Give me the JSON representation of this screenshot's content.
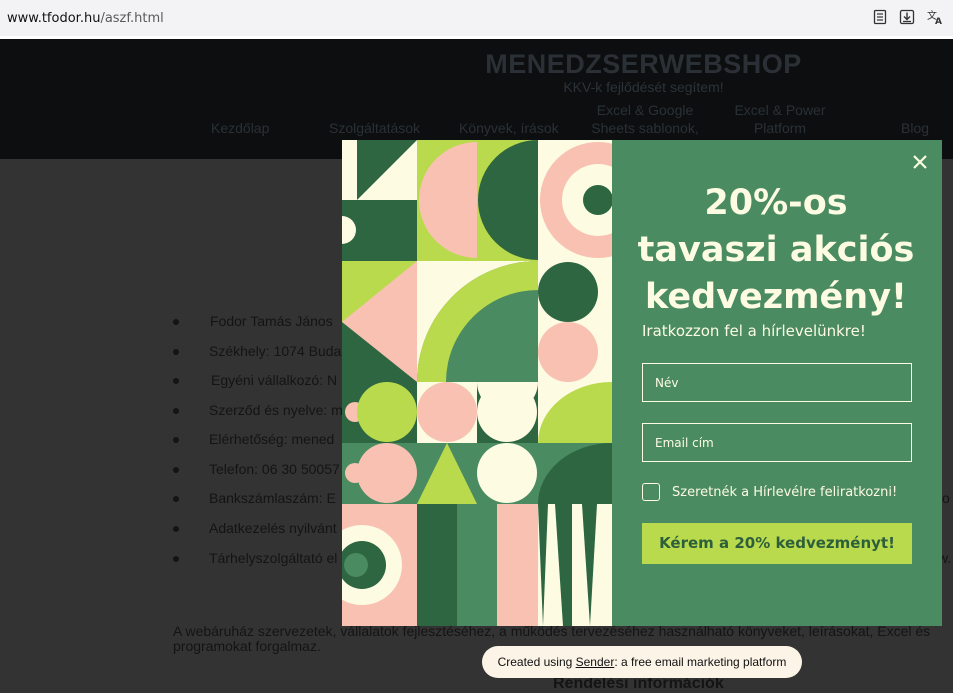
{
  "browser": {
    "url_host": "www.tfodor.hu",
    "url_path": "/aszf.html",
    "icons": [
      "reader-view-icon",
      "download-icon",
      "translate-icon"
    ]
  },
  "site": {
    "brand": "MENEDZSERWEBSHOP",
    "tagline": "KKV-k fejlődését segítem!",
    "nav": [
      "Kezdőlap",
      "Szolgáltatások",
      "Könyvek, írások",
      "Excel & Google Sheets sablonok,",
      "Excel & Power Platform",
      "Blog"
    ]
  },
  "page": {
    "items": [
      "Fodor Tamás János",
      "Székhely: 1074 Buda",
      "Egyéni vállalkozó:  N",
      "Szerződ és nyelve: m",
      "Elérhetőség: mened",
      "Telefon: 06 30 50057",
      "Bankszámlaszám: E",
      "Adatkezelés nyilvánt",
      "Tárhelyszolgáltató el"
    ],
    "items_right": [
      "co",
      "w."
    ],
    "paragraph": "A webáruház szervezetek, vállalatok fejlesztéséhez, a működés tervezéséhez használható könyveket, leírásokat, Excel és programokat forgalmaz.",
    "section_heading": "Rendelési információk"
  },
  "popup": {
    "headline_lines": [
      "20%-os",
      "tavaszi akciós",
      "kedvezmény!"
    ],
    "subtitle": "Iratkozzon fel a hírlevelünkre!",
    "name_placeholder": "Név",
    "email_placeholder": "Email cím",
    "checkbox_label": "Szeretnék a Hírlevélre feliratkozni!",
    "checkbox_checked": false,
    "submit_label": "Kérem a 20% kedvezményt!",
    "close_icon": "close-icon"
  },
  "credit": {
    "prefix": "Created using ",
    "link": "Sender",
    "suffix": ": a free email marketing platform"
  },
  "colors": {
    "popup_bg": "#4a8b61",
    "popup_text": "#fdfbe2",
    "button_bg": "#bada4d",
    "button_text": "#2d5f3b",
    "art_dark_green": "#2d6641",
    "art_lime": "#bada4d",
    "art_pink": "#f8c1b1",
    "art_cream": "#fdfbe2"
  }
}
